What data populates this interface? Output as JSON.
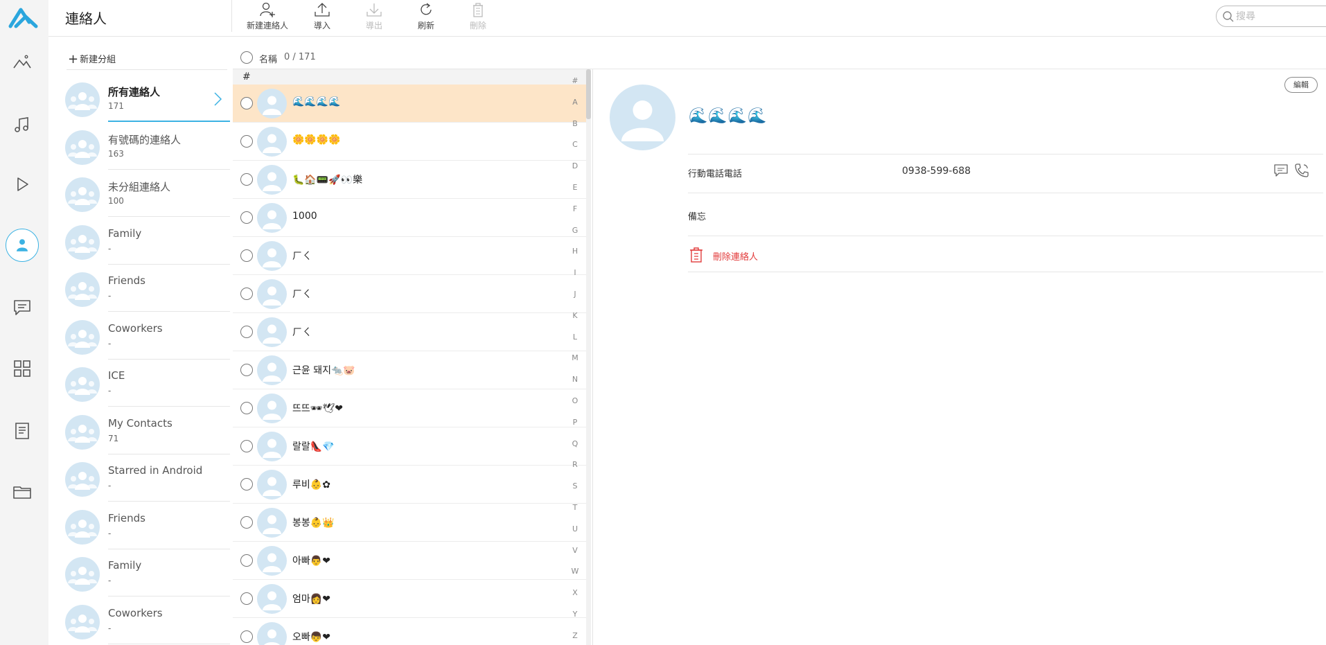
{
  "header": {
    "title": "連絡人",
    "toolbar": [
      {
        "label": "新建連絡人",
        "icon": "add-contact-icon",
        "enabled": true
      },
      {
        "label": "導入",
        "icon": "upload-icon",
        "enabled": true
      },
      {
        "label": "導出",
        "icon": "download-icon",
        "enabled": false
      },
      {
        "label": "刷新",
        "icon": "refresh-icon",
        "enabled": true
      },
      {
        "label": "刪除",
        "icon": "trash-icon",
        "enabled": false
      }
    ],
    "search_placeholder": "搜尋"
  },
  "rail": {
    "items": [
      "photos-icon",
      "music-icon",
      "video-icon",
      "contacts-icon",
      "messages-icon",
      "apps-icon",
      "notes-icon",
      "files-icon"
    ],
    "active": "contacts-icon",
    "accent": "#3bb2e3"
  },
  "groups": {
    "new_group_label": "新建分組",
    "items": [
      {
        "name": "所有連絡人",
        "count": "171"
      },
      {
        "name": "有號碼的連絡人",
        "count": "163"
      },
      {
        "name": "未分組連絡人",
        "count": "100"
      },
      {
        "name": "Family",
        "count": "-"
      },
      {
        "name": "Friends",
        "count": "-"
      },
      {
        "name": "Coworkers",
        "count": "-"
      },
      {
        "name": "ICE",
        "count": "-"
      },
      {
        "name": "My Contacts",
        "count": "71"
      },
      {
        "name": "Starred in Android",
        "count": "-"
      },
      {
        "name": "Friends",
        "count": "-"
      },
      {
        "name": "Family",
        "count": "-"
      },
      {
        "name": "Coworkers",
        "count": "-"
      }
    ]
  },
  "list": {
    "header_name": "名稱",
    "header_count": "0 / 171",
    "section": "#",
    "rows": [
      "🌊🌊🌊🌊",
      "🌼🌼🌼🌼",
      "🐛🏠📟🚀👀樂",
      "1000",
      "ㄏㄑ",
      "ㄏㄑ",
      "ㄏㄑ",
      "근윤 돼지🐀🐷",
      "뜨뜨🕶🕊❤",
      "랄랄👠💎",
      "루비👶✿",
      "봉봉👶👑",
      "아빠👨❤",
      "엄마👩❤",
      "오빠👦❤"
    ],
    "alphabet": [
      "#",
      "A",
      "B",
      "C",
      "D",
      "E",
      "F",
      "G",
      "H",
      "I",
      "J",
      "K",
      "L",
      "M",
      "N",
      "O",
      "P",
      "Q",
      "R",
      "S",
      "T",
      "U",
      "V",
      "W",
      "X",
      "Y",
      "Z"
    ],
    "selected_color": "#fde5c8"
  },
  "detail": {
    "edit_label": "編輯",
    "name": "🌊🌊🌊🌊",
    "phone_label": "行動電話電話",
    "phone_value": "0938-599-688",
    "memo_label": "備忘",
    "delete_label": "刪除連絡人",
    "delete_color": "#e23b3b"
  }
}
